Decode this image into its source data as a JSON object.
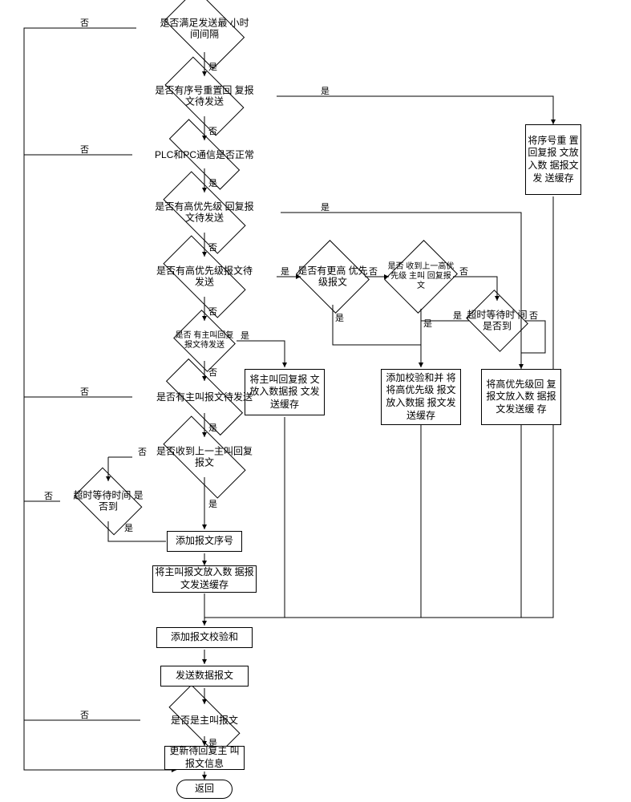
{
  "nodes": {
    "d1": "是否满足发送最\n小时间间隔",
    "d2": "是否有序号重置回\n复报文待发送",
    "d3": "PLC和PC通信是否正常",
    "d4": "是否有高优先级\n回复报文待发送",
    "d5": "是否有高优先级报文待\n发送",
    "d6": "是否\n有主叫回复\n报文待发送",
    "d7": "是否有主叫报文待发送",
    "d8": "是否收到上一主叫回复\n报文",
    "d9": "超时等待时间\n是否到",
    "d10": "是否是主叫报文",
    "d11": "是否有更高\n优先级报文",
    "d12": "是否\n收到上一高优先级\n主叫\n回复报文",
    "d13": "超时等待时\n间是否到",
    "r1": "将序号重\n置回复报\n文放入数\n据报文发\n送缓存",
    "r2": "将高优先级回\n复报文放入数\n据报文发送缓\n存",
    "r3": "添加校验和并\n将将高优先级\n报文放入数据\n报文发送缓存",
    "r4": "将主叫回复报\n文放入数据报\n文发送缓存",
    "r5": "添加报文序号",
    "r6": "将主叫报文放入数\n据报文发送缓存",
    "r7": "添加报文校验和",
    "r8": "发送数据报文",
    "r9": "更新待回复主\n叫报文信息",
    "t1": "返回"
  },
  "labels": {
    "yes": "是",
    "no": "否"
  }
}
